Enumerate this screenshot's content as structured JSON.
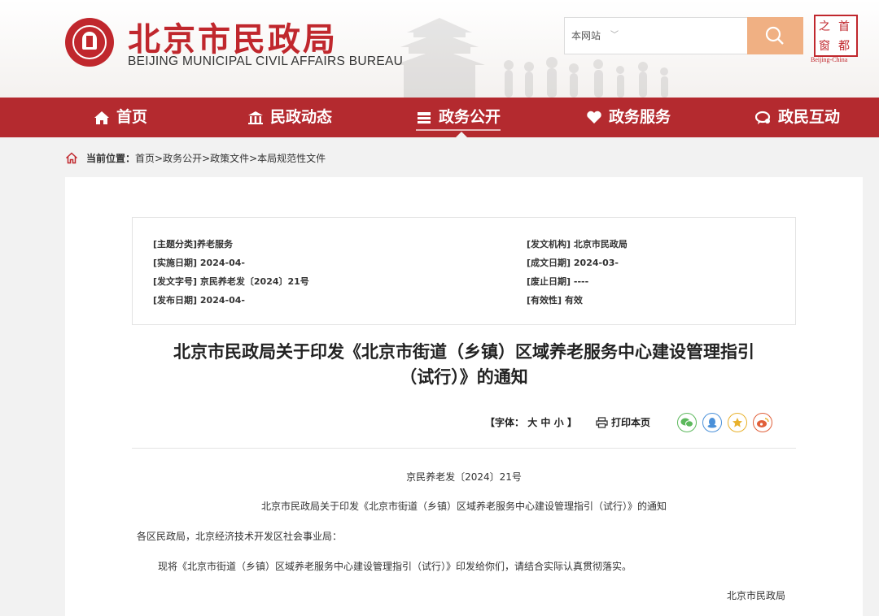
{
  "header": {
    "logo_cn": "北京市民政局",
    "logo_en": "BEIJING MUNICIPAL CIVIL AFFAIRS BUREAU",
    "search": {
      "scope": "本网站",
      "placeholder": ""
    },
    "badge_chars": [
      "之",
      "首",
      "窗",
      "都"
    ],
    "badge_en": "Beijing-China"
  },
  "nav": {
    "items": [
      {
        "label": "首页",
        "icon": "home-icon"
      },
      {
        "label": "民政动态",
        "icon": "building-icon"
      },
      {
        "label": "政务公开",
        "icon": "list-icon",
        "active": true
      },
      {
        "label": "政务服务",
        "icon": "heart-icon"
      },
      {
        "label": "政民互动",
        "icon": "chat-icon"
      }
    ]
  },
  "breadcrumb": {
    "label": "当前位置：",
    "path": "首页>政务公开>政策文件>本局规范性文件"
  },
  "meta": {
    "topic": "[主题分类]养老服务",
    "issuer": "[发文机构] 北京市民政局",
    "effective": "[实施日期] 2024-04-",
    "created": "[成文日期] 2024-03-",
    "doc_no": "[发文字号] 京民养老发〔2024〕21号",
    "abolish": "[废止日期] ----",
    "published": "[发布日期] 2024-04-",
    "validity": "[有效性] 有效"
  },
  "article": {
    "title_line1": "北京市民政局关于印发《北京市街道（乡镇）区域养老服务中心建设管理指引",
    "title_line2": "（试行）》的通知",
    "font_label": "【字体：",
    "font_large": "大",
    "font_medium": "中",
    "font_small": "小",
    "font_close": "】",
    "print_label": "打印本页",
    "doc_no": "京民养老发〔2024〕21号",
    "heading": "北京市民政局关于印发《北京市街道（乡镇）区域养老服务中心建设管理指引（试行）》的通知",
    "salutation": "各区民政局，北京经济技术开发区社会事业局：",
    "paragraph": "现将《北京市街道（乡镇）区域养老服务中心建设管理指引（试行）》印发给你们，请结合实际认真贯彻落实。",
    "signature": "北京市民政局"
  },
  "colors": {
    "brand": "#b42a2f",
    "search_btn": "#f0b083",
    "wechat": "#5cb85c",
    "qq": "#4a90d9",
    "favorite": "#e8b12b",
    "weibo": "#e0603a"
  }
}
